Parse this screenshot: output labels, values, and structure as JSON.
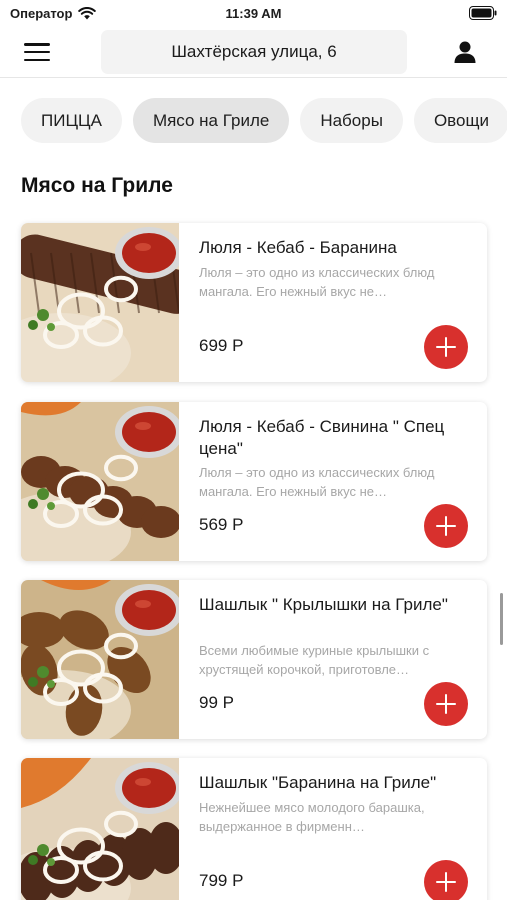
{
  "status_bar": {
    "carrier": "Оператор",
    "time": "11:39 AM"
  },
  "header": {
    "address": "Шахтёрская улица, 6"
  },
  "categories": [
    "ПИЦЦА",
    "Мясо на Гриле",
    "Наборы",
    "Овощи"
  ],
  "active_category": "Мясо на Гриле",
  "section": {
    "title": "Мясо на Гриле"
  },
  "products": [
    {
      "title": "Люля - Кебаб - Баранина",
      "description": "Люля – это одно из классических блюд мангала. Его нежный вкус не…",
      "price": "699 Р"
    },
    {
      "title": "Люля - Кебаб - Свинина \" Спец цена\"",
      "description": "Люля – это одно из классических блюд мангала. Его нежный вкус не…",
      "price": "569 Р"
    },
    {
      "title": "Шашлык \" Крылышки на Гриле\"",
      "description": "Всеми любимые куриные крылышки с хрустящей корочкой, приготовле…",
      "price": "99 Р"
    },
    {
      "title": "Шашлык \"Баранина на Гриле\"",
      "description": "Нежнейшее мясо молодого барашка, выдержанное в фирменн…",
      "price": "799 Р"
    }
  ],
  "colors": {
    "accent": "#d8302d",
    "chip_bg": "#f2f2f2",
    "chip_active_bg": "#e4e4e4",
    "muted_text": "#a7a7a7"
  },
  "icons": {
    "menu": "hamburger-icon",
    "profile": "person-icon",
    "add": "plus-icon"
  }
}
